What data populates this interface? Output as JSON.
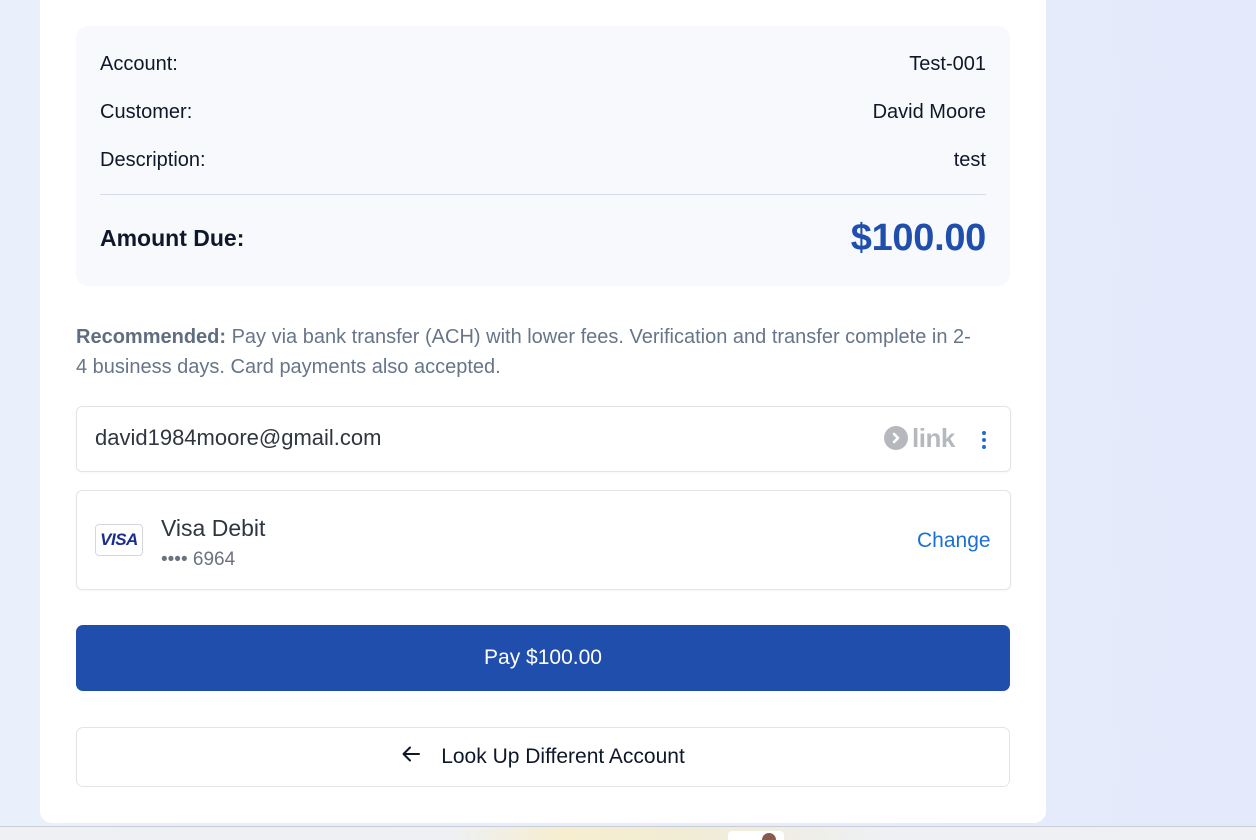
{
  "summary": {
    "account_label": "Account:",
    "account_value": "Test-001",
    "customer_label": "Customer:",
    "customer_value": "David Moore",
    "description_label": "Description:",
    "description_value": "test",
    "amount_label": "Amount Due:",
    "amount_value": "$100.00"
  },
  "notice": {
    "bold": "Recommended:",
    "text": " Pay via bank transfer (ACH) with lower fees. Verification and transfer complete in 2-4 business days. Card payments also accepted."
  },
  "link": {
    "email": "david1984moore@gmail.com",
    "logo_text": "link",
    "icons": [
      "link-arrow-icon",
      "more-vertical-icon"
    ]
  },
  "payment_method": {
    "card_brand_badge": "VISA",
    "name": "Visa Debit",
    "masked_number": "•••• 6964",
    "change_label": "Change"
  },
  "pay_button_label": "Pay $100.00",
  "back_button_label": "Look Up Different Account",
  "colors": {
    "accent": "#1f4ead",
    "link_blue": "#1d6fd6",
    "background": "#e8edfb",
    "summary_bg": "#f7f9fc"
  }
}
